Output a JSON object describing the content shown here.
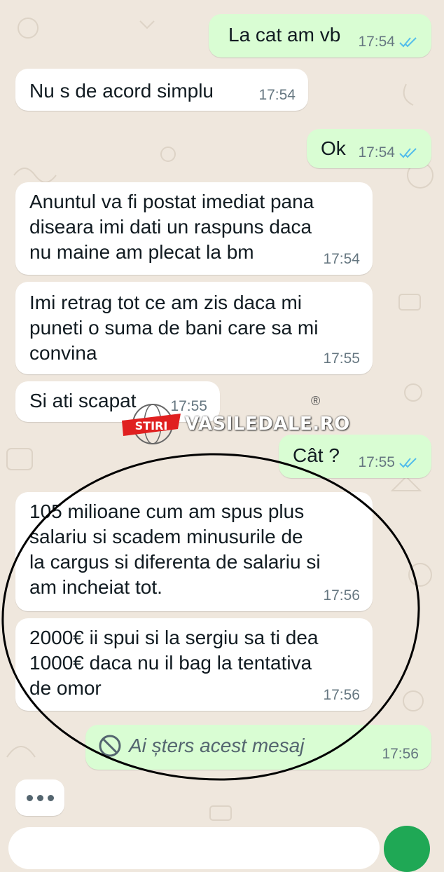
{
  "messages": [
    {
      "id": "m1",
      "dir": "out",
      "text": "La cat am vb",
      "time": "17:54",
      "read": true
    },
    {
      "id": "m2",
      "dir": "in",
      "text": "Nu s de acord simplu",
      "time": "17:54"
    },
    {
      "id": "m3",
      "dir": "out",
      "text": "Ok",
      "time": "17:54",
      "read": true
    },
    {
      "id": "m4",
      "dir": "in",
      "lines": [
        "Anuntul va fi postat imediat pana",
        "diseara imi dati un raspuns daca",
        "nu maine am plecat la bm"
      ],
      "time": "17:54"
    },
    {
      "id": "m5",
      "dir": "in",
      "lines": [
        "Imi retrag tot ce am zis daca mi",
        "puneti o suma de bani care sa mi",
        "convina"
      ],
      "time": "17:55"
    },
    {
      "id": "m6",
      "dir": "in",
      "text": "Si ati scapat",
      "time": "17:55"
    },
    {
      "id": "m7",
      "dir": "out",
      "text": "Cât ?",
      "time": "17:55",
      "read": true
    },
    {
      "id": "m8",
      "dir": "in",
      "lines": [
        "105 milioane cum am spus plus",
        "salariu si scadem minusurile de",
        "la cargus si diferenta de salariu si",
        "am incheiat tot."
      ],
      "time": "17:56"
    },
    {
      "id": "m9",
      "dir": "in",
      "lines": [
        "2000€ ii spui si la sergiu sa ti dea",
        "1000€ daca nu il bag la tentativa",
        "de omor"
      ],
      "time": "17:56"
    },
    {
      "id": "m10",
      "dir": "out",
      "text": "Ai șters acest mesaj",
      "time": "17:56",
      "deleted": true
    }
  ],
  "watermark": {
    "logo_text": "STIRI",
    "site": "VASILEDALE.RO",
    "mark": "®"
  },
  "colors": {
    "incoming": "#ffffff",
    "outgoing": "#d9fdd3",
    "read_ticks": "#53bdeb",
    "send_button": "#1fa855",
    "wallpaper": "#efe7dd",
    "circle_annotation": "#000000"
  },
  "icons": {
    "read_receipt": "double-check-icon",
    "deleted": "blocked-icon",
    "typing": "typing-dots-icon",
    "send": "send-button"
  }
}
